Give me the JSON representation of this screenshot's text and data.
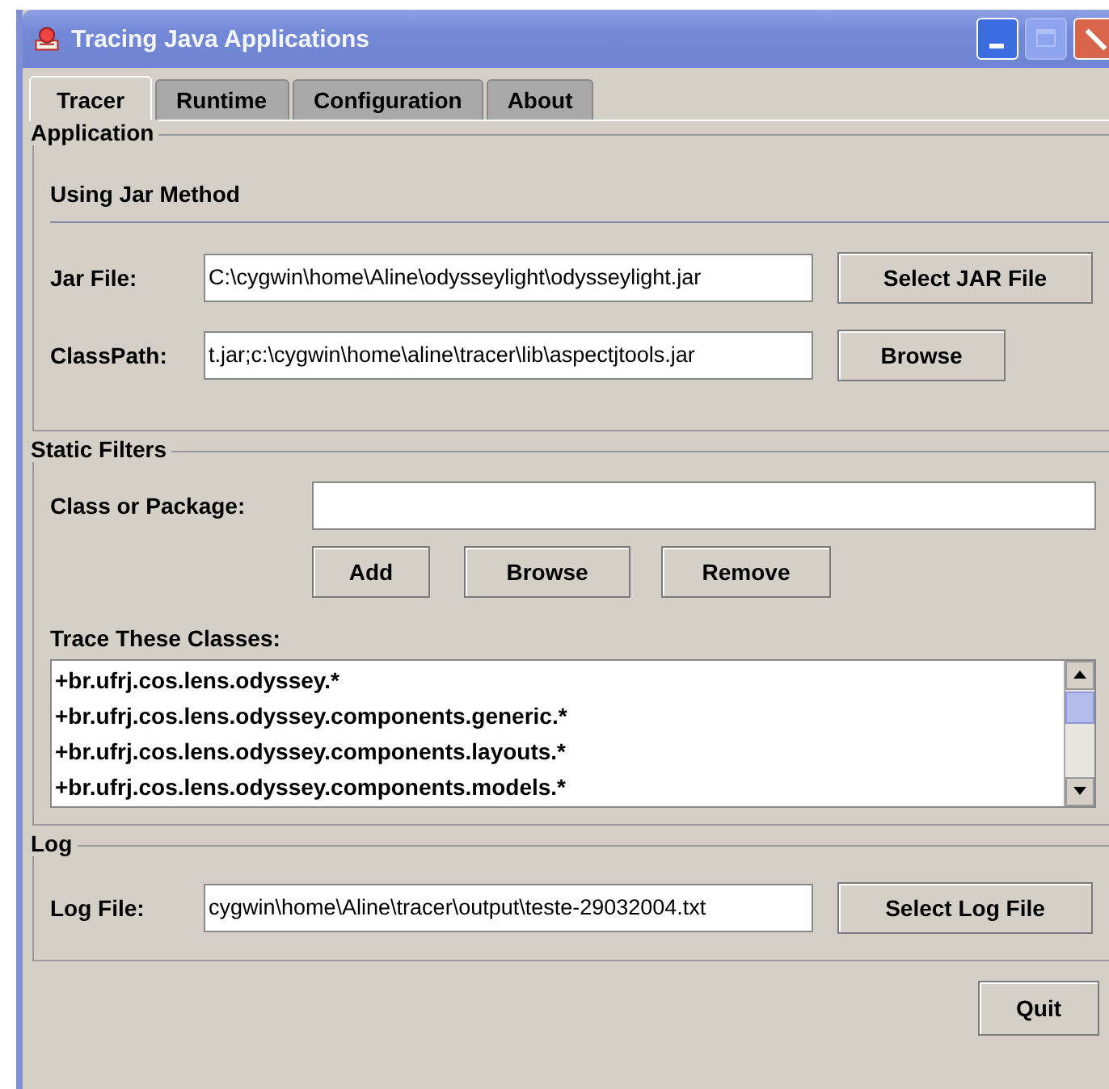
{
  "window": {
    "title": "Tracing Java Applications",
    "controls": [
      {
        "kind": "minimize",
        "disabled": false
      },
      {
        "kind": "maximize",
        "disabled": true
      },
      {
        "kind": "close",
        "disabled": false
      }
    ]
  },
  "tabs": [
    {
      "label": "Tracer",
      "selected": true
    },
    {
      "label": "Runtime",
      "selected": false
    },
    {
      "label": "Configuration",
      "selected": false
    },
    {
      "label": "About",
      "selected": false
    }
  ],
  "application": {
    "title": "Application",
    "subtitle": "Using Jar Method",
    "rows": [
      {
        "label": "Jar File:",
        "value": "C:\\cygwin\\home\\Aline\\odysseylight\\odysseylight.jar",
        "button": "Select JAR File"
      },
      {
        "label": "ClassPath:",
        "value": "t.jar;c:\\cygwin\\home\\aline\\tracer\\lib\\aspectjtools.jar",
        "button": "Browse"
      }
    ]
  },
  "static_filters": {
    "title": "Static Filters",
    "field_label": "Class or Package:",
    "buttons": [
      "Add",
      "Browse",
      "Remove"
    ],
    "list_label": "Trace These Classes:",
    "classes": [
      "+br.ufrj.cos.lens.odyssey.*",
      "+br.ufrj.cos.lens.odyssey.components.generic.*",
      "+br.ufrj.cos.lens.odyssey.components.layouts.*",
      "+br.ufrj.cos.lens.odyssey.components.models.*"
    ]
  },
  "log": {
    "title": "Log",
    "label": "Log File:",
    "value": "cygwin\\home\\Aline\\tracer\\output\\teste-29032004.txt",
    "button": "Select Log File"
  },
  "buttons": [
    "Quit"
  ]
}
